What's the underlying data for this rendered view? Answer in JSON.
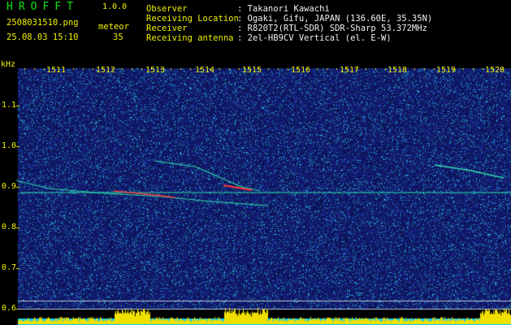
{
  "header": {
    "app_name": "HROFFT",
    "version": "1.0.0",
    "filename": "2508031510.png",
    "datetime": "25.08.03 15:10",
    "meteor_label": "meteor",
    "meteor_count": "35",
    "info_labels": [
      "Observer",
      "Receiving Location",
      "Receiver",
      "Receiving antenna"
    ],
    "info_values": [
      ": Takanori Kawachi",
      ": Ogaki, Gifu, JAPAN (136.60E, 35.35N)",
      ": R820T2(RTL-SDR) SDR-Sharp 53.372MHz",
      ": 2el-HB9CV Vertical (el. E-W)"
    ]
  },
  "spectrogram": {
    "y_unit": "kHz",
    "y_ticks": [
      "1.1",
      "1.0",
      "0.9",
      "0.8",
      "0.7",
      "0.6"
    ],
    "x_ticks": [
      "1511",
      "1512",
      "1513",
      "1514",
      "1515",
      "1516",
      "1517",
      "1518",
      "1519",
      "1520"
    ]
  },
  "colors": {
    "background": "#000000",
    "noise": "#0b1a86",
    "signal": "#2ee0b0",
    "signal_hot": "#ff3a3a",
    "axis_text": "#f0f000",
    "bar_fill": "#f0e000",
    "bar_base": "#00c8ff"
  }
}
